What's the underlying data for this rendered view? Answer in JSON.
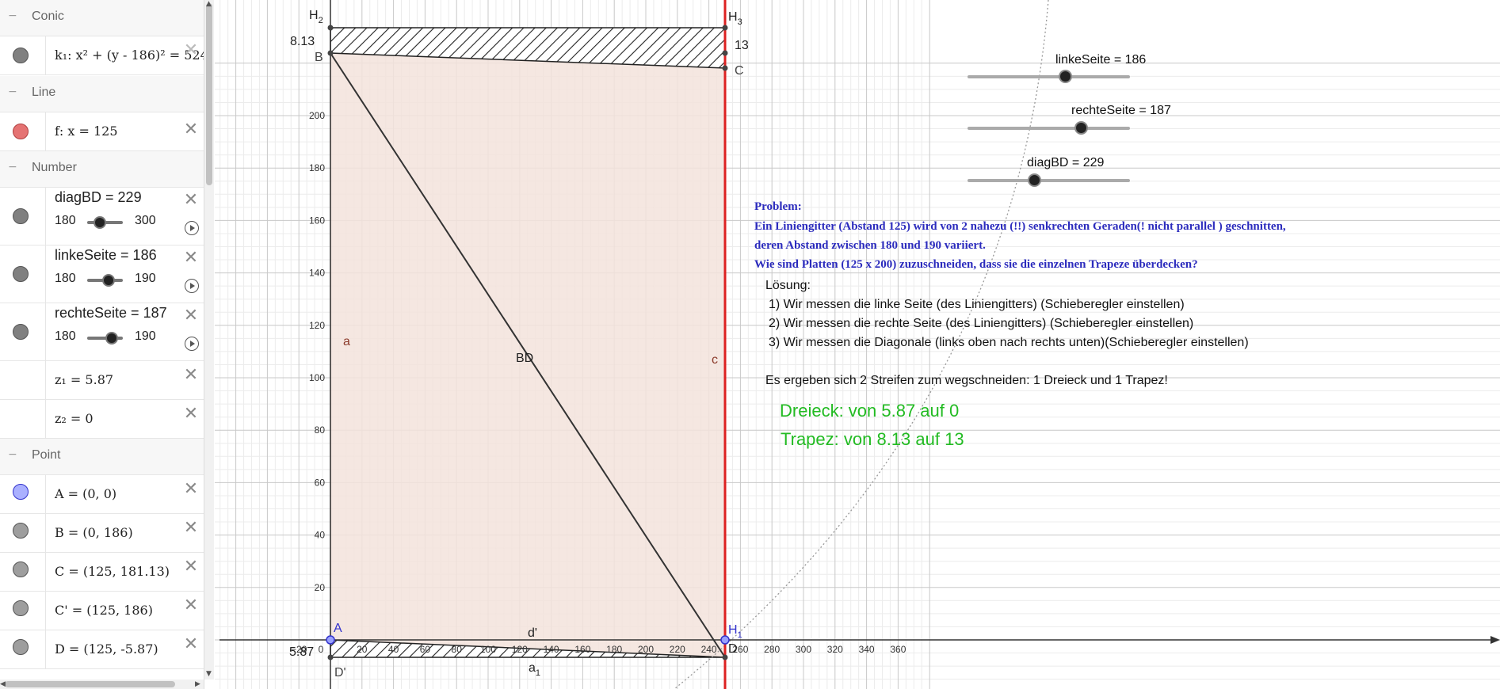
{
  "algebra": {
    "categories": {
      "conic": "Conic",
      "line": "Line",
      "number": "Number",
      "point": "Point"
    },
    "conic_k1": "k₁: x² + (y - 186)² = 524",
    "line_f": "f: x = 125",
    "diagBD": {
      "label": "diagBD = 229",
      "min": "180",
      "max": "300",
      "value_fraction": 0.41
    },
    "linkeSeite": {
      "label": "linkeSeite = 186",
      "min": "180",
      "max": "190",
      "value_fraction": 0.6
    },
    "rechteSeite": {
      "label": "rechteSeite = 187",
      "min": "180",
      "max": "190",
      "value_fraction": 0.7
    },
    "z1": "z₁ = 5.87",
    "z2": "z₂ = 0",
    "pointA": "A = (0, 0)",
    "pointB": "B = (0, 186)",
    "pointC": "C = (125, 181.13)",
    "pointCp": "C' = (125, 186)",
    "pointD": "D = (125, -5.87)",
    "colors": {
      "conic": "#808080",
      "line": "#e57373",
      "pointA": "#9999ff",
      "point": "#9e9e9e",
      "number": "#808080"
    }
  },
  "graph": {
    "x_ticks": [
      "−20",
      "0",
      "20",
      "40",
      "60",
      "80",
      "100",
      "120",
      "140",
      "160",
      "180",
      "200",
      "220",
      "240",
      "260",
      "280",
      "300",
      "320",
      "340",
      "360"
    ],
    "y_ticks": [
      "20",
      "40",
      "60",
      "80",
      "100",
      "120",
      "140",
      "160",
      "180",
      "200"
    ],
    "labels": {
      "H2": "H",
      "H2_sub": "2",
      "H3": "H",
      "H3_sub": "3",
      "H1": "H",
      "H1_sub": "1",
      "B": "B",
      "C": "C",
      "A": "A",
      "D": "D",
      "Dp": "D'",
      "a": "a",
      "c": "c",
      "BD": "BD",
      "dp": "d'",
      "a1": "a",
      "a1_sub": "1",
      "top_left_val": "8.13",
      "top_right_val": "13",
      "bottom_left_val": "5.87"
    },
    "sliders": [
      {
        "label": "linkeSeite = 186",
        "fraction": 0.6
      },
      {
        "label": "rechteSeite = 187",
        "fraction": 0.7
      },
      {
        "label": "diagBD = 229",
        "fraction": 0.41
      }
    ],
    "problem": [
      "Problem:",
      "Ein Liniengitter (Abstand 125)  wird von 2 nahezu (!!) senkrechten Geraden(! nicht parallel ) geschnitten,",
      "deren Abstand zwischen 180 und 190 variiert.",
      "Wie sind Platten (125 x 200) zuzuschneiden, dass sie die einzelnen Trapeze überdecken?"
    ],
    "solution": [
      "Lösung:",
      "1) Wir messen die linke Seite (des Liniengitters) (Schieberegler einstellen)",
      "2) Wir messen die rechte Seite (des Liniengitters) (Schieberegler einstellen)",
      "3) Wir messen die Diagonale (links oben nach rechts unten)(Schieberegler einstellen)",
      "Es ergeben sich 2 Streifen zum wegschneiden: 1 Dreieck und 1 Trapez!"
    ],
    "result1": "Dreieck: von 5.87 auf 0",
    "result2": "Trapez: von 8.13 auf 13",
    "colors": {
      "problem": "#2b2bbd",
      "result": "#22bb22",
      "line_f": "#dd2222",
      "fill": "#f3e3dc"
    }
  }
}
